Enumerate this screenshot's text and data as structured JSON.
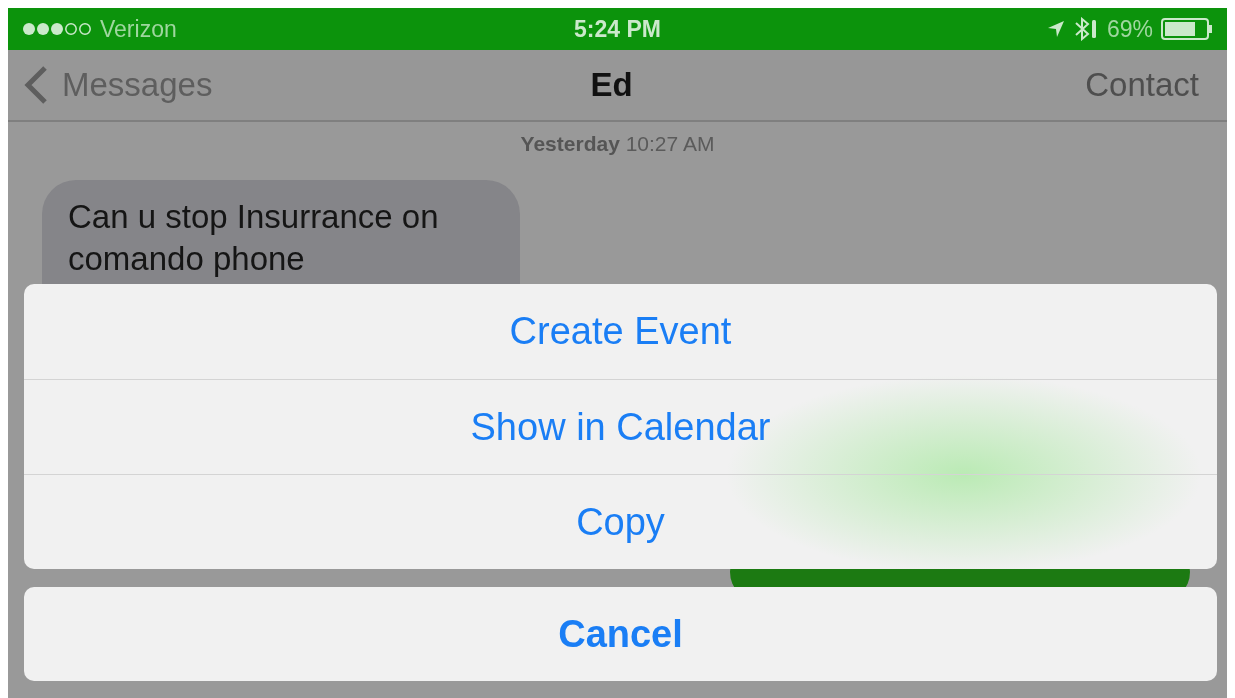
{
  "status_bar": {
    "carrier": "Verizon",
    "time": "5:24 PM",
    "battery_percent": "69%"
  },
  "nav_bar": {
    "back": "Messages",
    "title": "Ed",
    "action": "Contact"
  },
  "timestamp": {
    "day": "Yesterday",
    "time": "10:27 AM"
  },
  "messages": [
    {
      "kind": "incoming",
      "text": "Can u stop Insurrance on\ncomando phone"
    },
    {
      "kind": "outgoing"
    }
  ],
  "action_sheet": {
    "actions": [
      "Create Event",
      "Show in Calendar",
      "Copy"
    ],
    "cancel": "Cancel"
  }
}
